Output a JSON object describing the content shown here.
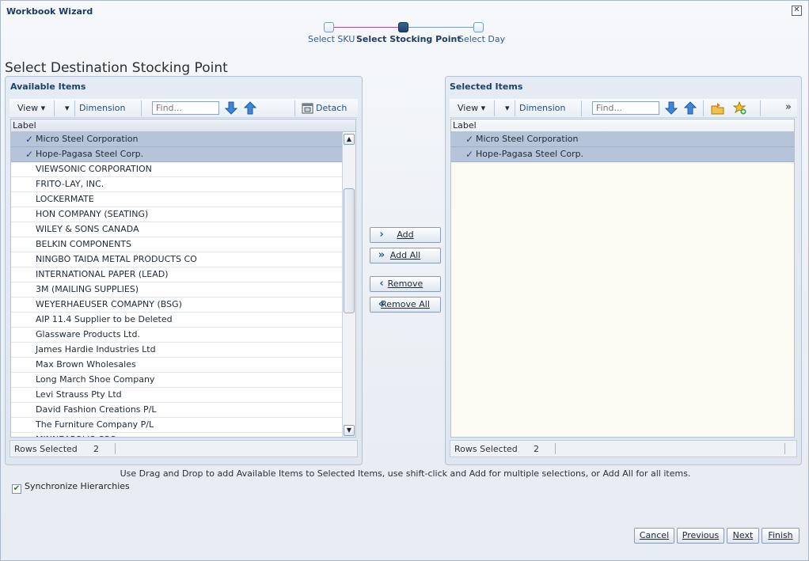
{
  "window": {
    "title": "Workbook Wizard"
  },
  "train": {
    "steps": [
      {
        "label": "Select SKU"
      },
      {
        "label": "Select Stocking Point"
      },
      {
        "label": "Select Day"
      }
    ],
    "active_step": 1
  },
  "page": {
    "heading": "Select Destination Stocking Point"
  },
  "available": {
    "title": "Available Items",
    "toolbar": {
      "view": "View",
      "dimension": "Dimension",
      "find_placeholder": "Find...",
      "detach": "Detach"
    },
    "column": "Label",
    "rows": [
      {
        "label": "Micro Steel Corporation",
        "selected": true
      },
      {
        "label": "Hope-Pagasa Steel Corp.",
        "selected": true
      },
      {
        "label": "VIEWSONIC CORPORATION",
        "selected": false
      },
      {
        "label": "FRITO-LAY, INC.",
        "selected": false
      },
      {
        "label": "LOCKERMATE",
        "selected": false
      },
      {
        "label": "HON COMPANY (SEATING)",
        "selected": false
      },
      {
        "label": "WILEY & SONS CANADA",
        "selected": false
      },
      {
        "label": "BELKIN COMPONENTS",
        "selected": false
      },
      {
        "label": "NINGBO TAIDA METAL PRODUCTS CO",
        "selected": false
      },
      {
        "label": "INTERNATIONAL PAPER (LEAD)",
        "selected": false
      },
      {
        "label": "3M (MAILING SUPPLIES)",
        "selected": false
      },
      {
        "label": "WEYERHAEUSER COMAPNY (BSG)",
        "selected": false
      },
      {
        "label": "AIP 11.4 Supplier to be Deleted",
        "selected": false
      },
      {
        "label": "Glassware Products Ltd.",
        "selected": false
      },
      {
        "label": "James Hardie Industries Ltd",
        "selected": false
      },
      {
        "label": "Max Brown Wholesales",
        "selected": false
      },
      {
        "label": "Long March Shoe Company",
        "selected": false
      },
      {
        "label": "Levi Strauss Pty Ltd",
        "selected": false
      },
      {
        "label": "David Fashion Creations P/L",
        "selected": false
      },
      {
        "label": "The Furniture Company P/L",
        "selected": false
      },
      {
        "label": "MINNEAPOLIS CSC",
        "selected": false
      }
    ],
    "status_label": "Rows Selected",
    "status_count": "2"
  },
  "selected": {
    "title": "Selected Items",
    "toolbar": {
      "view": "View",
      "dimension": "Dimension",
      "find_placeholder": "Find...",
      "overflow": "»"
    },
    "column": "Label",
    "rows": [
      {
        "label": "Micro Steel Corporation",
        "selected": true
      },
      {
        "label": "Hope-Pagasa Steel Corp.",
        "selected": true
      }
    ],
    "status_label": "Rows Selected",
    "status_count": "2"
  },
  "shuttle": {
    "add": "Add",
    "add_all": "Add All",
    "remove": "Remove",
    "remove_all": "Remove All"
  },
  "hint": "Use Drag and Drop to add Available Items to Selected Items, use shift-click and Add for multiple selections, or Add All for all items.",
  "sync": {
    "label": "Synchronize Hierarchies",
    "checked": true
  },
  "footer": {
    "cancel": "Cancel",
    "previous": "Previous",
    "next": "Next",
    "finish": "Finish"
  },
  "colors": {
    "selected_row": "#b6c4da",
    "accent": "#1f4f8b",
    "active_step": "#1e4369"
  }
}
